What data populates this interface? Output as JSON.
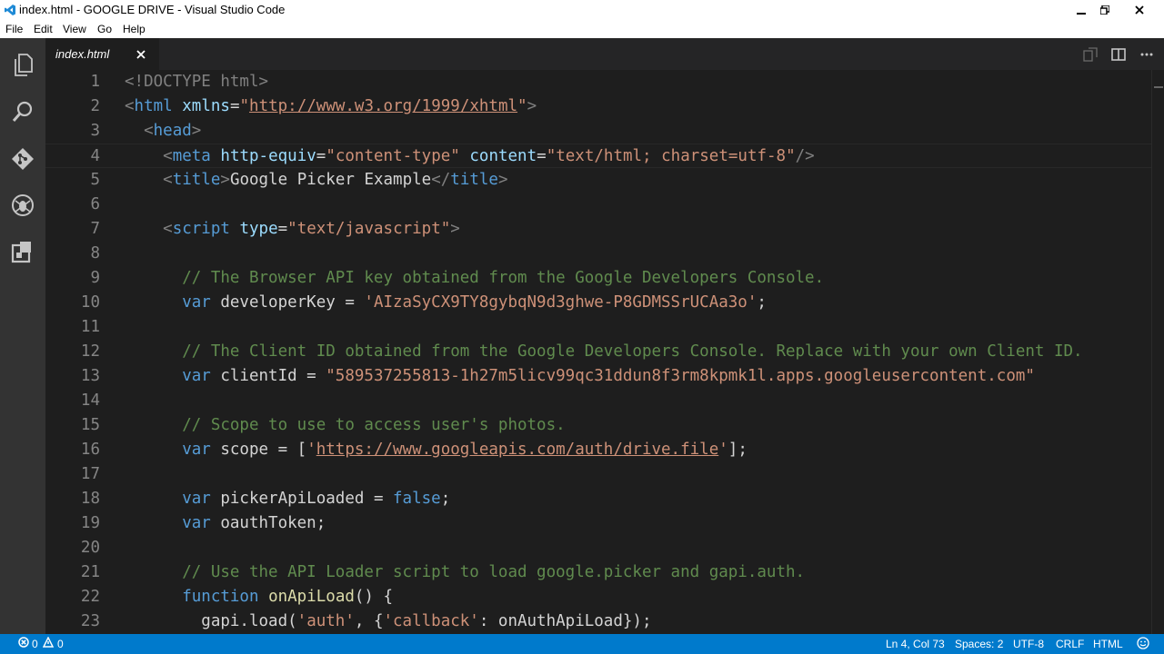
{
  "window": {
    "title": "index.html - GOOGLE DRIVE - Visual Studio Code"
  },
  "menu": [
    "File",
    "Edit",
    "View",
    "Go",
    "Help"
  ],
  "tab": {
    "label": "index.html"
  },
  "activity_icons": [
    "files-icon",
    "search-icon",
    "git-icon",
    "debug-icon",
    "extensions-icon"
  ],
  "editor": {
    "current_line": 4,
    "lines": [
      {
        "num": "1",
        "tokens": [
          [
            "t-br",
            "<!DOCTYPE html>"
          ]
        ]
      },
      {
        "num": "2",
        "tokens": [
          [
            "t-br",
            "<"
          ],
          [
            "t-tag",
            "html"
          ],
          [
            "t-txt",
            " "
          ],
          [
            "t-attr",
            "xmlns"
          ],
          [
            "t-txt",
            "="
          ],
          [
            "t-str",
            "\""
          ],
          [
            "t-url",
            "http://www.w3.org/1999/xhtml"
          ],
          [
            "t-str",
            "\""
          ],
          [
            "t-br",
            ">"
          ]
        ]
      },
      {
        "num": "3",
        "tokens": [
          [
            "t-txt",
            "  "
          ],
          [
            "t-br",
            "<"
          ],
          [
            "t-tag",
            "head"
          ],
          [
            "t-br",
            ">"
          ]
        ]
      },
      {
        "num": "4",
        "tokens": [
          [
            "t-txt",
            "    "
          ],
          [
            "t-br",
            "<"
          ],
          [
            "t-tag",
            "meta"
          ],
          [
            "t-txt",
            " "
          ],
          [
            "t-attr",
            "http-equiv"
          ],
          [
            "t-txt",
            "="
          ],
          [
            "t-str",
            "\"content-type\""
          ],
          [
            "t-txt",
            " "
          ],
          [
            "t-attr",
            "content"
          ],
          [
            "t-txt",
            "="
          ],
          [
            "t-str",
            "\"text/html; charset=utf-8\""
          ],
          [
            "t-br",
            "/>"
          ]
        ]
      },
      {
        "num": "5",
        "tokens": [
          [
            "t-txt",
            "    "
          ],
          [
            "t-br",
            "<"
          ],
          [
            "t-tag",
            "title"
          ],
          [
            "t-br",
            ">"
          ],
          [
            "t-txt",
            "Google Picker Example"
          ],
          [
            "t-br",
            "</"
          ],
          [
            "t-tag",
            "title"
          ],
          [
            "t-br",
            ">"
          ]
        ]
      },
      {
        "num": "6",
        "tokens": []
      },
      {
        "num": "7",
        "tokens": [
          [
            "t-txt",
            "    "
          ],
          [
            "t-br",
            "<"
          ],
          [
            "t-tag",
            "script"
          ],
          [
            "t-txt",
            " "
          ],
          [
            "t-attr",
            "type"
          ],
          [
            "t-txt",
            "="
          ],
          [
            "t-str",
            "\"text/javascript\""
          ],
          [
            "t-br",
            ">"
          ]
        ]
      },
      {
        "num": "8",
        "tokens": []
      },
      {
        "num": "9",
        "tokens": [
          [
            "t-txt",
            "      "
          ],
          [
            "t-com",
            "// The Browser API key obtained from the Google Developers Console."
          ]
        ]
      },
      {
        "num": "10",
        "tokens": [
          [
            "t-txt",
            "      "
          ],
          [
            "t-kw",
            "var"
          ],
          [
            "t-txt",
            " developerKey = "
          ],
          [
            "t-str",
            "'AIzaSyCX9TY8gybqN9d3ghwe-P8GDMSSrUCAa3o'"
          ],
          [
            "t-txt",
            ";"
          ]
        ]
      },
      {
        "num": "11",
        "tokens": []
      },
      {
        "num": "12",
        "tokens": [
          [
            "t-txt",
            "      "
          ],
          [
            "t-com",
            "// The Client ID obtained from the Google Developers Console. Replace with your own Client ID."
          ]
        ]
      },
      {
        "num": "13",
        "tokens": [
          [
            "t-txt",
            "      "
          ],
          [
            "t-kw",
            "var"
          ],
          [
            "t-txt",
            " clientId = "
          ],
          [
            "t-str",
            "\"589537255813-1h27m5licv99qc31ddun8f3rm8kpmk1l.apps.googleusercontent.com\""
          ]
        ]
      },
      {
        "num": "14",
        "tokens": []
      },
      {
        "num": "15",
        "tokens": [
          [
            "t-txt",
            "      "
          ],
          [
            "t-com",
            "// Scope to use to access user's photos."
          ]
        ]
      },
      {
        "num": "16",
        "tokens": [
          [
            "t-txt",
            "      "
          ],
          [
            "t-kw",
            "var"
          ],
          [
            "t-txt",
            " scope = ["
          ],
          [
            "t-str",
            "'"
          ],
          [
            "t-url",
            "https://www.googleapis.com/auth/drive.file"
          ],
          [
            "t-str",
            "'"
          ],
          [
            "t-txt",
            "];"
          ]
        ]
      },
      {
        "num": "17",
        "tokens": []
      },
      {
        "num": "18",
        "tokens": [
          [
            "t-txt",
            "      "
          ],
          [
            "t-kw",
            "var"
          ],
          [
            "t-txt",
            " pickerApiLoaded = "
          ],
          [
            "t-kw",
            "false"
          ],
          [
            "t-txt",
            ";"
          ]
        ]
      },
      {
        "num": "19",
        "tokens": [
          [
            "t-txt",
            "      "
          ],
          [
            "t-kw",
            "var"
          ],
          [
            "t-txt",
            " oauthToken;"
          ]
        ]
      },
      {
        "num": "20",
        "tokens": []
      },
      {
        "num": "21",
        "tokens": [
          [
            "t-txt",
            "      "
          ],
          [
            "t-com",
            "// Use the API Loader script to load google.picker and gapi.auth."
          ]
        ]
      },
      {
        "num": "22",
        "tokens": [
          [
            "t-txt",
            "      "
          ],
          [
            "t-kw",
            "function"
          ],
          [
            "t-txt",
            " "
          ],
          [
            "t-fn",
            "onApiLoad"
          ],
          [
            "t-txt",
            "() {"
          ]
        ]
      },
      {
        "num": "23",
        "tokens": [
          [
            "t-txt",
            "        gapi.load("
          ],
          [
            "t-str",
            "'auth'"
          ],
          [
            "t-txt",
            ", {"
          ],
          [
            "t-str",
            "'callback'"
          ],
          [
            "t-txt",
            ": onAuthApiLoad});"
          ]
        ]
      }
    ]
  },
  "status": {
    "errors": "0",
    "warnings": "0",
    "position": "Ln 4, Col 73",
    "spaces": "Spaces: 2",
    "encoding": "UTF-8",
    "eol": "CRLF",
    "language": "HTML"
  }
}
